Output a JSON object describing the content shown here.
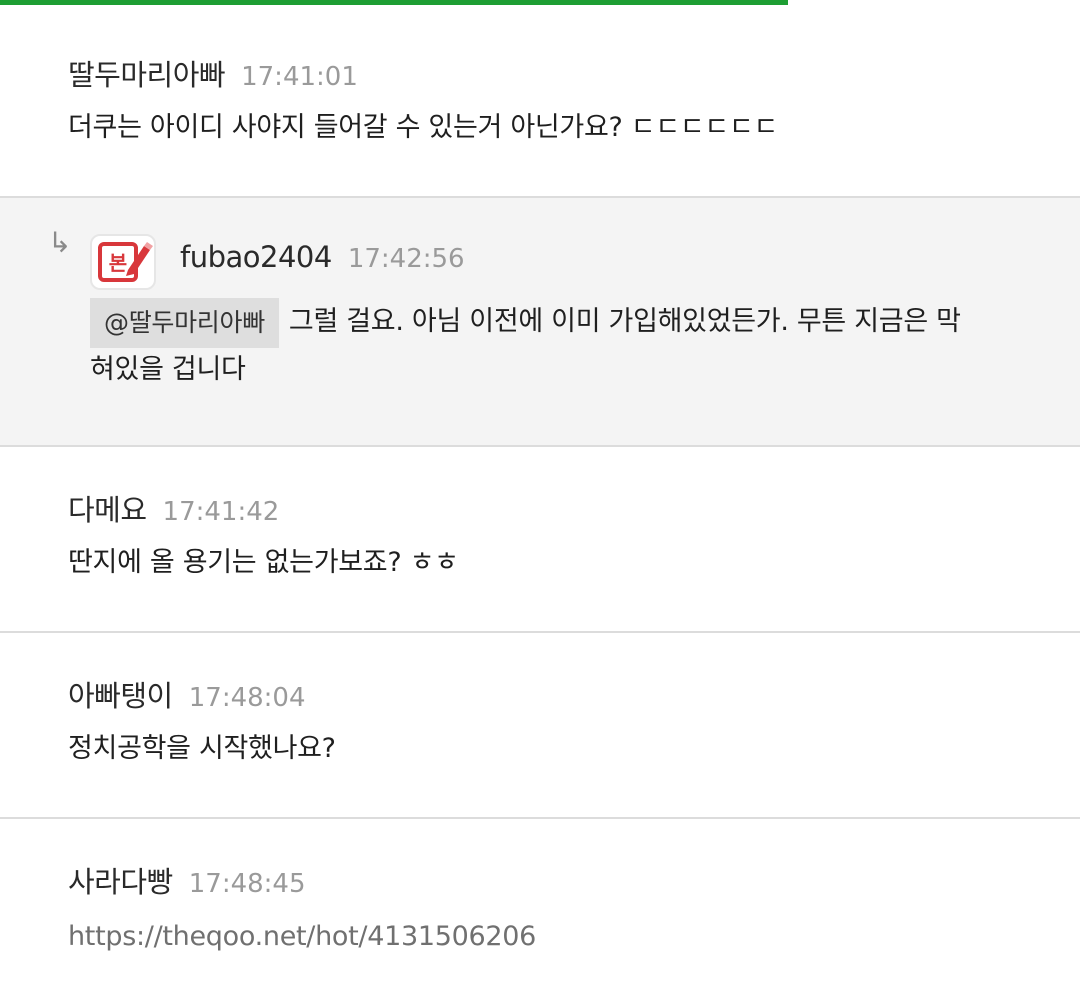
{
  "page": {
    "load_progress": 0.73,
    "accent_color": "#1e9e33"
  },
  "comments": [
    {
      "author": "딸두마리아빠",
      "time": "17:41:01",
      "text": "더쿠는 아이디 사야지 들어갈 수 있는거 아닌가요? ㄷㄷㄷㄷㄷㄷ"
    },
    {
      "reply": true,
      "reply_icon": "reply-arrow-icon",
      "avatar_icon": "pencil-badge-icon",
      "author": "fubao2404",
      "time": "17:42:56",
      "mention": "@딸두마리아빠",
      "text": "그럴 걸요. 아님 이전에 이미 가입해있었든가. 무튼 지금은 막",
      "text_cont": "혀있을 겁니다"
    },
    {
      "author": "다메요",
      "time": "17:41:42",
      "text": "딴지에 올 용기는 없는가보죠? ㅎㅎ"
    },
    {
      "author": "아빠탱이",
      "time": "17:48:04",
      "text": "정치공학을 시작했나요?"
    },
    {
      "author": "사라다빵",
      "time": "17:48:45",
      "link": "https://theqoo.net/hot/4131506206"
    }
  ]
}
